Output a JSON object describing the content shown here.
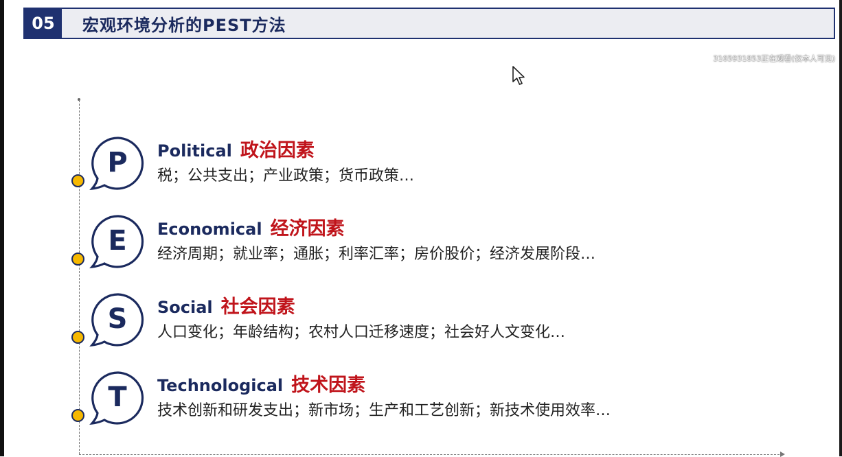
{
  "header": {
    "number": "05",
    "title": "宏观环境分析的PEST方法"
  },
  "watermark": "3165931853正在观看(仅本人可见)",
  "factors": [
    {
      "letter": "P",
      "en": "Political",
      "cn": "政治因素",
      "desc": "税；公共支出；产业政策；货币政策…"
    },
    {
      "letter": "E",
      "en": "Economical",
      "cn": "经济因素",
      "desc": "经济周期；就业率；通胀；利率汇率；房价股价；经济发展阶段…"
    },
    {
      "letter": "S",
      "en": "Social",
      "cn": "社会因素",
      "desc": "人口变化；年龄结构；农村人口迁移速度；社会好人文变化…"
    },
    {
      "letter": "T",
      "en": "Technological",
      "cn": "技术因素",
      "desc": "技术创新和研发支出；新市场；生产和工艺创新；新技术使用效率…"
    }
  ],
  "colors": {
    "navy": "#1b2a5e",
    "red": "#c0141b",
    "yellow": "#f6b800",
    "header_bg": "#ecedf2"
  }
}
